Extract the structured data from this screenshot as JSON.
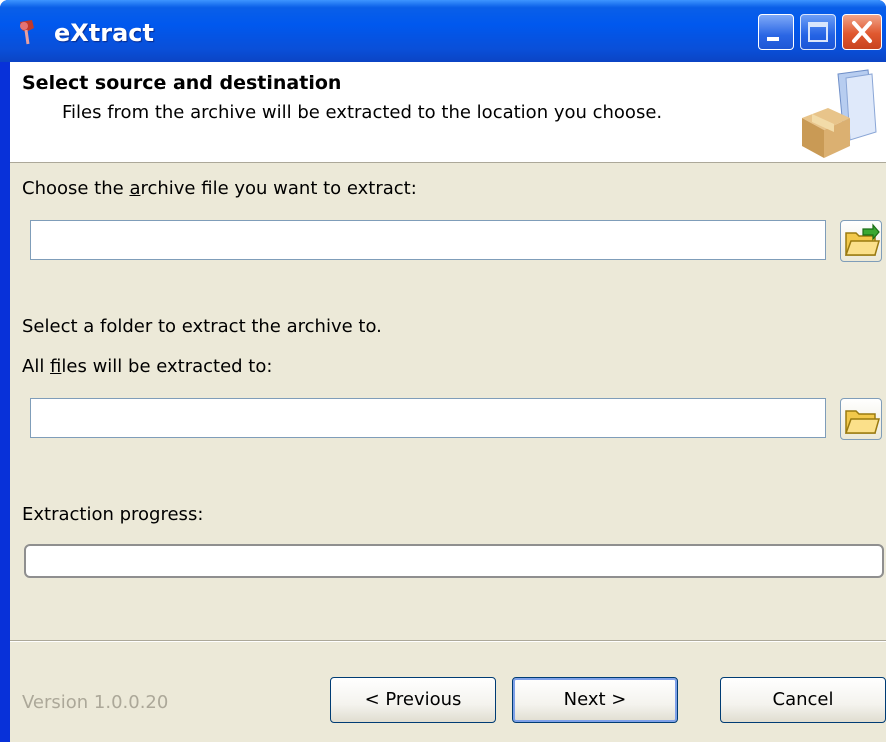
{
  "window": {
    "title": "eXtract"
  },
  "header": {
    "title": "Select source and destination",
    "subtitle": "Files from the archive will be extracted to the location you choose."
  },
  "source": {
    "label_pre": "Choose the ",
    "label_accel": "a",
    "label_post": "rchive file you want to extract:",
    "value": ""
  },
  "destination": {
    "intro": "Select a folder to extract the archive to.",
    "label_pre": "All ",
    "label_accel": "f",
    "label_post": "iles will be extracted to:",
    "value": ""
  },
  "progress": {
    "label": "Extraction progress:",
    "fraction": 0
  },
  "footer": {
    "version": "Version 1.0.0.20",
    "previous_label": "< Previous",
    "next_label": "Next >",
    "cancel_label": "Cancel"
  },
  "icons": {
    "app": "app-icon",
    "header": "box-folder-icon",
    "open_archive": "open-folder-arrow-icon",
    "browse_folder": "folder-icon"
  },
  "colors": {
    "titlebar": "#0058ee",
    "client": "#ece9d8",
    "close": "#e0582f"
  }
}
